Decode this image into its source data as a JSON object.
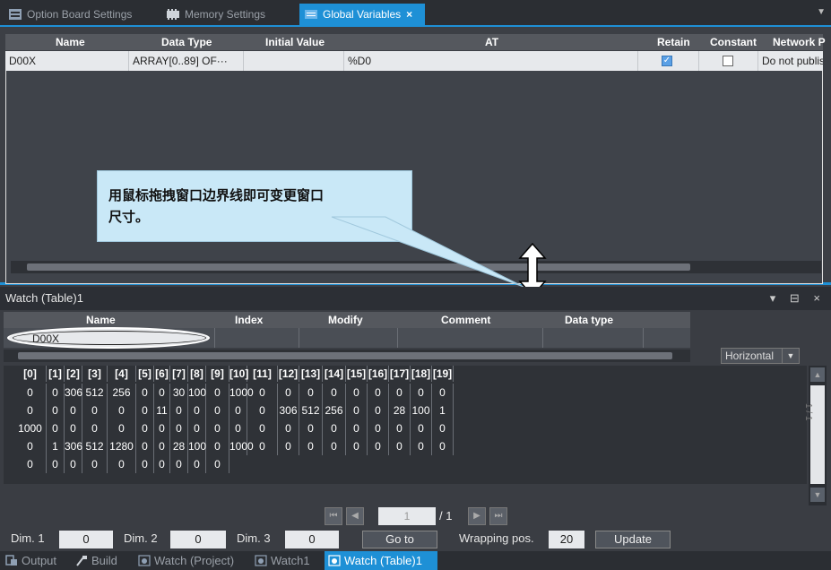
{
  "top_tabs": [
    {
      "label": "Option Board Settings",
      "icon": "board-icon"
    },
    {
      "label": "Memory Settings",
      "icon": "memory-icon"
    },
    {
      "label": "Global Variables",
      "icon": "variables-icon",
      "close": "×"
    }
  ],
  "gv_table": {
    "headers": [
      "Name",
      "Data Type",
      "Initial Value",
      "AT",
      "Retain",
      "Constant",
      "Network P"
    ],
    "row": {
      "name": "D00X",
      "data_type": "ARRAY[0..89] OF···",
      "initial_value": "",
      "at": "%D0",
      "retain": true,
      "constant": false,
      "network": "Do not publis"
    }
  },
  "callout": {
    "text_line1": "用鼠标拖拽窗口边界线即可变更窗口",
    "text_line2": "尺寸。"
  },
  "watch": {
    "title": "Watch (Table)1",
    "controls": "▾ ⊟ ×",
    "headers": [
      "Name",
      "Index",
      "Modify",
      "Comment",
      "Data type"
    ],
    "name_value": "D00X",
    "orientation": "Horizontal",
    "grid_headers": [
      "[0]",
      "[1]",
      "[2]",
      "[3]",
      "[4]",
      "[5]",
      "[6]",
      "[7]",
      "[8]",
      "[9]",
      "[10]",
      "[11]",
      "[12]",
      "[13]",
      "[14]",
      "[15]",
      "[16]",
      "[17]",
      "[18]",
      "[19]"
    ],
    "grid_rows": [
      [
        "0",
        "0",
        "306",
        "512",
        "256",
        "0",
        "0",
        "30",
        "100",
        "0",
        "1000",
        "0",
        "0",
        "0",
        "0",
        "0",
        "0",
        "0",
        "0",
        "0"
      ],
      [
        "0",
        "0",
        "0",
        "0",
        "0",
        "0",
        "11",
        "0",
        "0",
        "0",
        "0",
        "0",
        "306",
        "512",
        "256",
        "0",
        "0",
        "28",
        "100",
        "1"
      ],
      [
        "1000",
        "0",
        "0",
        "0",
        "0",
        "0",
        "0",
        "0",
        "0",
        "0",
        "0",
        "0",
        "0",
        "0",
        "0",
        "0",
        "0",
        "0",
        "0",
        "0"
      ],
      [
        "0",
        "1",
        "306",
        "512",
        "1280",
        "0",
        "0",
        "28",
        "100",
        "0",
        "1000",
        "0",
        "0",
        "0",
        "0",
        "0",
        "0",
        "0",
        "0",
        "0"
      ],
      [
        "0",
        "0",
        "0",
        "0",
        "0",
        "0",
        "0",
        "0",
        "0",
        "0"
      ]
    ],
    "vscroll_label": "1 / 1",
    "pager": {
      "page": "1",
      "total": "/ 1"
    },
    "dim1_label": "Dim. 1",
    "dim1_value": "0",
    "dim2_label": "Dim. 2",
    "dim2_value": "0",
    "dim3_label": "Dim. 3",
    "dim3_value": "0",
    "goto_label": "Go to",
    "wrap_label": "Wrapping pos.",
    "wrap_value": "20",
    "update_label": "Update"
  },
  "bottom_tabs": [
    {
      "label": "Output",
      "icon": "output-icon"
    },
    {
      "label": "Build",
      "icon": "build-icon"
    },
    {
      "label": "Watch (Project)",
      "icon": "watch-icon"
    },
    {
      "label": "Watch1",
      "icon": "watch-icon"
    },
    {
      "label": "Watch (Table)1",
      "icon": "watch-icon"
    }
  ],
  "colors": {
    "accent": "#1e90d6",
    "callout_bg": "#c9e8f7"
  }
}
